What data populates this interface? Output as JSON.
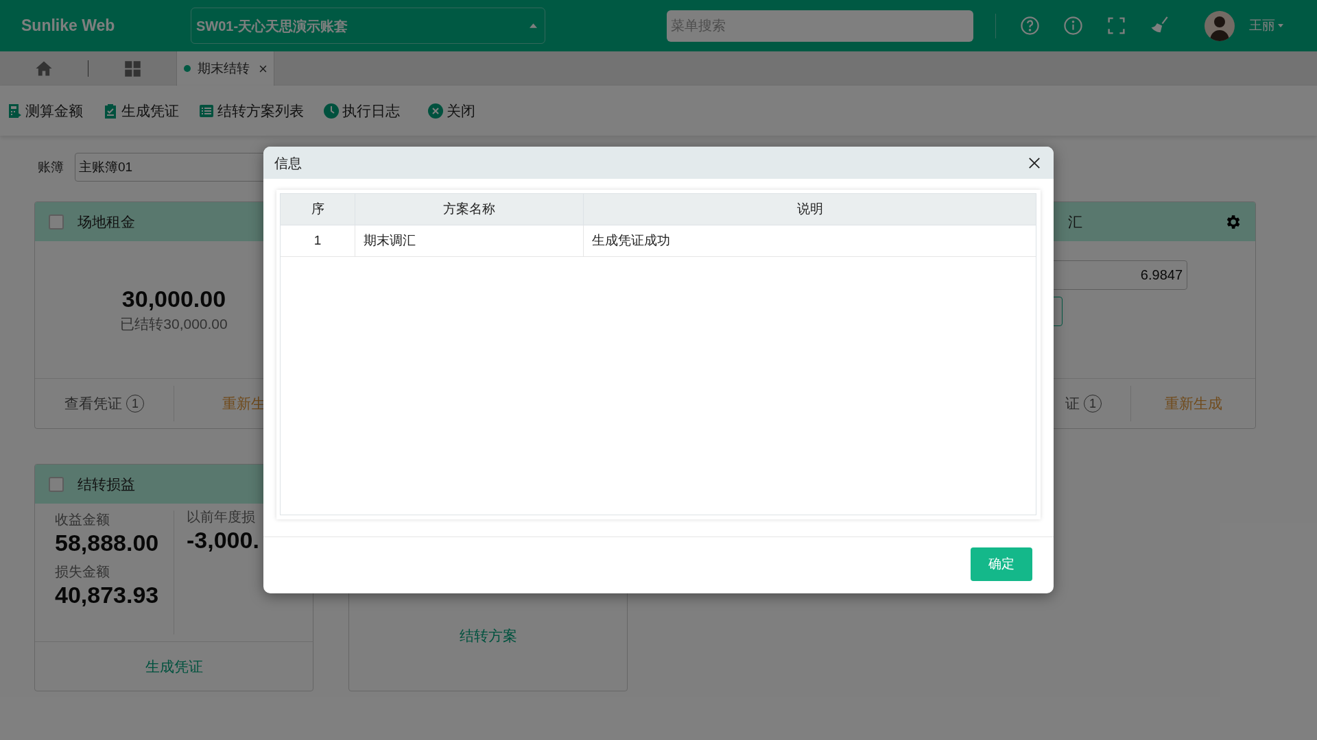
{
  "header": {
    "logo": "Sunlike Web",
    "account": "SW01-天心天思演示账套",
    "search": {
      "placeholder": "菜单搜索"
    },
    "user": "王丽"
  },
  "tabs": [
    {
      "label": "期末结转",
      "selected": true
    }
  ],
  "toolbar": [
    {
      "kind": "calc",
      "label": "测算金额"
    },
    {
      "kind": "clipboard",
      "label": "生成凭证"
    },
    {
      "kind": "list",
      "label": "结转方案列表"
    },
    {
      "kind": "clock",
      "label": "执行日志"
    },
    {
      "kind": "close",
      "label": "关闭"
    }
  ],
  "ledger": {
    "label": "账簿",
    "value": "主账簿01"
  },
  "cards": [
    {
      "kind": "amount",
      "title": "场地租金",
      "checked": false,
      "amount": "30,000.00",
      "note": "已结转30,000.00",
      "actions": [
        {
          "kind": "view",
          "label": "查看凭证",
          "count": "1"
        },
        {
          "kind": "regen",
          "label": "重新生"
        }
      ]
    },
    {
      "kind": "exchange",
      "title": "汇",
      "rate": "6.9847",
      "actions": [
        {
          "kind": "view",
          "label": "证",
          "count": "1"
        },
        {
          "kind": "regen",
          "label": "重新生成"
        }
      ]
    },
    {
      "kind": "profit",
      "title": "结转损益",
      "checked": false,
      "income_label": "收益金额",
      "income": "58,888.00",
      "loss_label": "损失金额",
      "loss": "40,873.93",
      "prior_label": "以前年度损",
      "prior": "-3,000.",
      "actions": [
        {
          "kind": "generate",
          "label": "生成凭证"
        }
      ]
    },
    {
      "kind": "footer_only",
      "actions": [
        {
          "kind": "generate",
          "label": "结转方案"
        }
      ]
    }
  ],
  "dialog": {
    "title": "信息",
    "columns": [
      "序",
      "方案名称",
      "说明"
    ],
    "rows": [
      [
        "1",
        "期末调汇",
        "生成凭证成功"
      ]
    ],
    "ok": "确定"
  }
}
